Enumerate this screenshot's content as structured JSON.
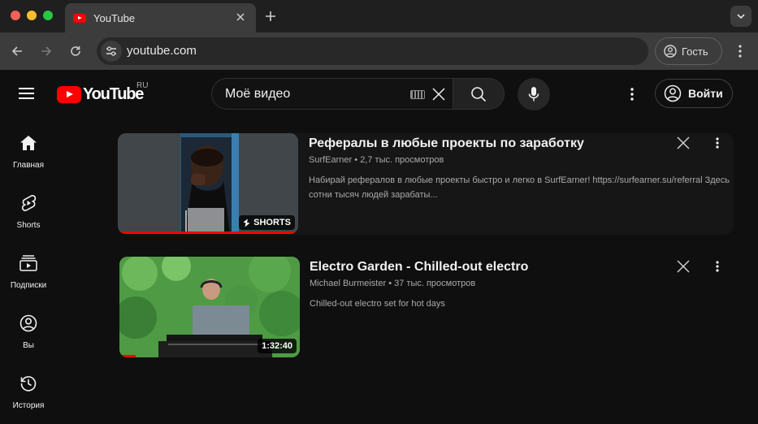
{
  "browser": {
    "tab_title": "YouTube",
    "url": "youtube.com",
    "profile_label": "Гость",
    "traffic_colors": [
      "#ff5f57",
      "#febc2e",
      "#28c840"
    ]
  },
  "header": {
    "logo_text": "YouTube",
    "region": "RU",
    "search_value": "Моё видео",
    "signin_label": "Войти",
    "brand_color": "#ff0000"
  },
  "guide": {
    "items": [
      {
        "label": "Главная",
        "icon": "home-icon"
      },
      {
        "label": "Shorts",
        "icon": "shorts-icon"
      },
      {
        "label": "Подписки",
        "icon": "subscriptions-icon"
      },
      {
        "label": "Вы",
        "icon": "you-icon"
      },
      {
        "label": "История",
        "icon": "history-icon"
      }
    ]
  },
  "results": [
    {
      "title": "Рефералы в любые проекты по заработку",
      "channel": "SurfEarner",
      "views": "2,7 тыс. просмотров",
      "description": "Набирай рефералов в любые проекты быстро и легко в SurfEarner! https://surfearner.su/referral Здесь сотни тысяч людей зарабаты...",
      "badge": "SHORTS",
      "progress": 1.0
    },
    {
      "title": "Electro Garden - Chilled-out electro",
      "channel": "Michael Burmeister",
      "views": "37 тыс. просмотров",
      "description": "Chilled-out electro set for hot days",
      "badge": "1:32:40",
      "progress": 0.09
    }
  ]
}
